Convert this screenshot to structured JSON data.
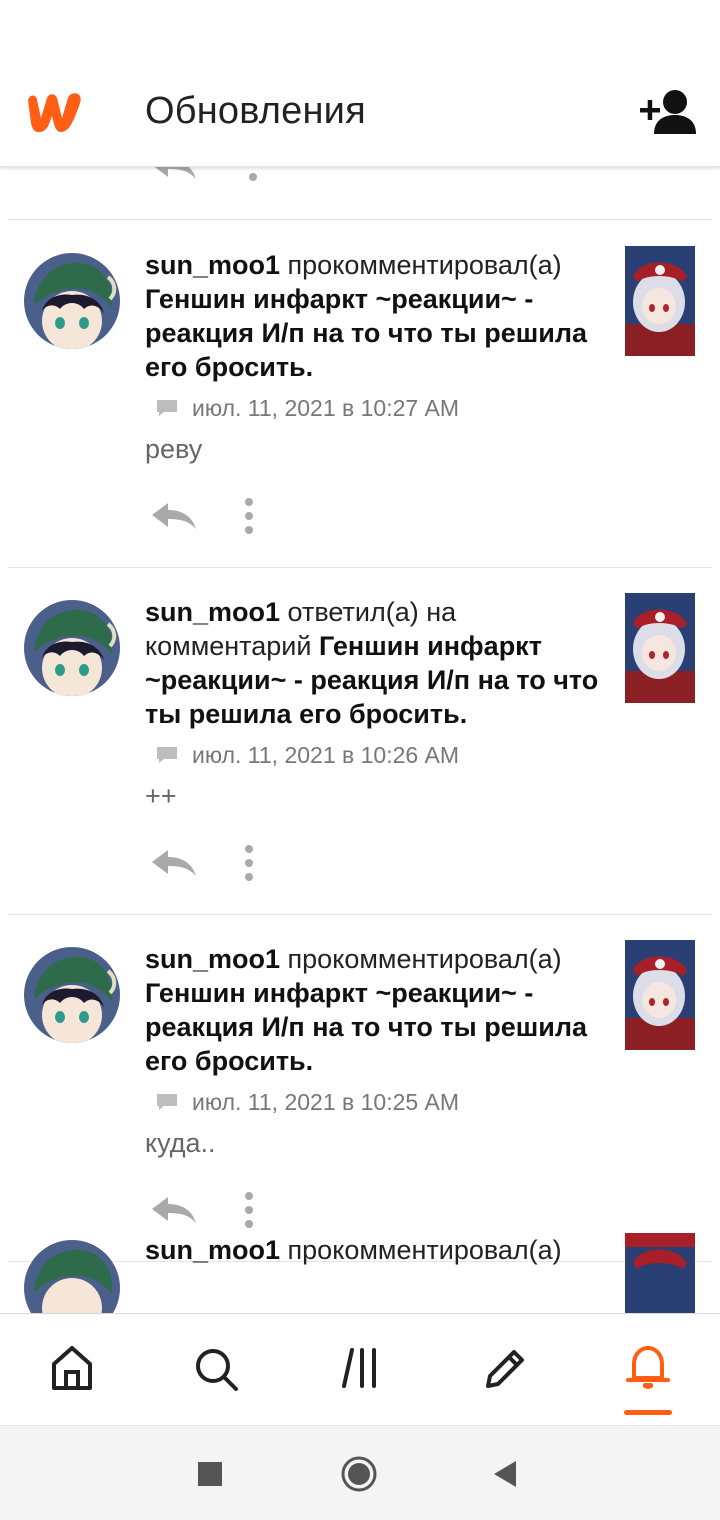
{
  "app": {
    "brand": "Wattpad",
    "accent_color": "#ff5e14"
  },
  "header": {
    "title": "Обновления",
    "action_icon": "add-user-icon"
  },
  "notifications": [
    {
      "user": "sun_moo1",
      "action": "прокомментировал(а)",
      "story": "Геншин инфаркт ~реакции~ - реакция И/п на то что ты решила его бросить.",
      "time": "июл. 11, 2021 в 10:27 AM",
      "comment": "реву"
    },
    {
      "user": "sun_moo1",
      "action": "ответил(а) на комментарий",
      "story": "Геншин инфаркт ~реакции~ - реакция И/п на то что ты решила его бросить.",
      "time": "июл. 11, 2021 в 10:26 AM",
      "comment": "++"
    },
    {
      "user": "sun_moo1",
      "action": "прокомментировал(а)",
      "story": "Геншин инфаркт ~реакции~ - реакция И/п на то что ты решила его бросить.",
      "time": "июл. 11, 2021 в 10:25 AM",
      "comment": "куда.."
    },
    {
      "user": "sun_moo1",
      "action": "прокомментировал(а)"
    }
  ],
  "bottom_nav": [
    {
      "icon": "home-icon",
      "active": false
    },
    {
      "icon": "search-icon",
      "active": false
    },
    {
      "icon": "library-icon",
      "active": false
    },
    {
      "icon": "pencil-icon",
      "active": false
    },
    {
      "icon": "bell-icon",
      "active": true
    }
  ],
  "system_nav": [
    "recent-apps-icon",
    "home-circle-icon",
    "back-icon"
  ]
}
